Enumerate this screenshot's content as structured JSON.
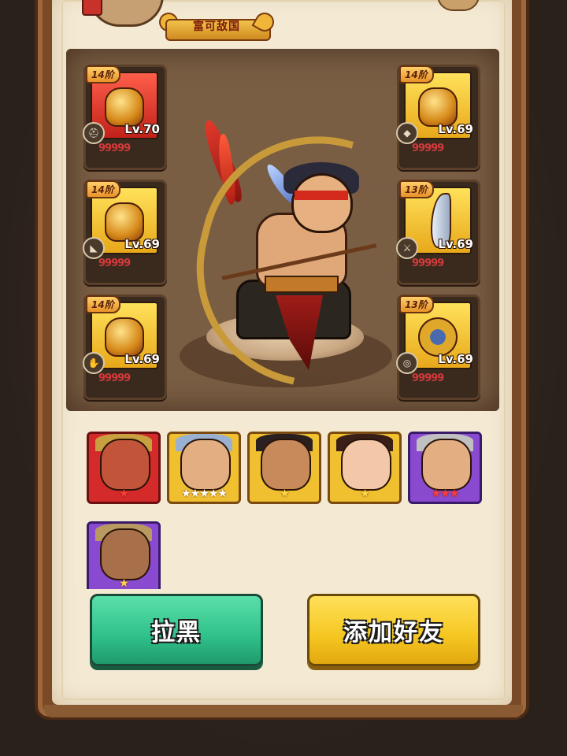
{
  "header": {
    "kingdom_label": "富可敌国"
  },
  "equipment": {
    "left": [
      {
        "tier": "14阶",
        "level": "Lv.70",
        "color": "red",
        "stars": "99999",
        "type_icon": "helmet-icon"
      },
      {
        "tier": "14阶",
        "level": "Lv.69",
        "color": "gold",
        "stars": "99999",
        "type_icon": "boot-icon"
      },
      {
        "tier": "14阶",
        "level": "Lv.69",
        "color": "gold",
        "stars": "99999",
        "type_icon": "glove-icon"
      }
    ],
    "right": [
      {
        "tier": "14阶",
        "level": "Lv.69",
        "color": "gold",
        "stars": "99999",
        "type_icon": "armor-icon"
      },
      {
        "tier": "13阶",
        "level": "Lv.69",
        "color": "gold",
        "stars": "99999",
        "type_icon": "weapon-icon"
      },
      {
        "tier": "13阶",
        "level": "Lv.69",
        "color": "gold",
        "stars": "99999",
        "type_icon": "ring-icon"
      }
    ]
  },
  "roster": [
    {
      "frame": "red",
      "stars": "★",
      "star_style": "red"
    },
    {
      "frame": "gold",
      "stars": "★★★★★",
      "star_style": "white"
    },
    {
      "frame": "gold",
      "stars": "★",
      "star_style": "gold"
    },
    {
      "frame": "gold",
      "stars": "★",
      "star_style": "gold"
    },
    {
      "frame": "purple",
      "stars": "★★★",
      "star_style": "red"
    },
    {
      "frame": "purple",
      "stars": "★",
      "star_style": "gold"
    }
  ],
  "actions": {
    "block_label": "拉黑",
    "add_friend_label": "添加好友"
  },
  "colors": {
    "block_button": "#2fc08a",
    "add_button": "#f5c620",
    "paper": "#f4ead4"
  }
}
